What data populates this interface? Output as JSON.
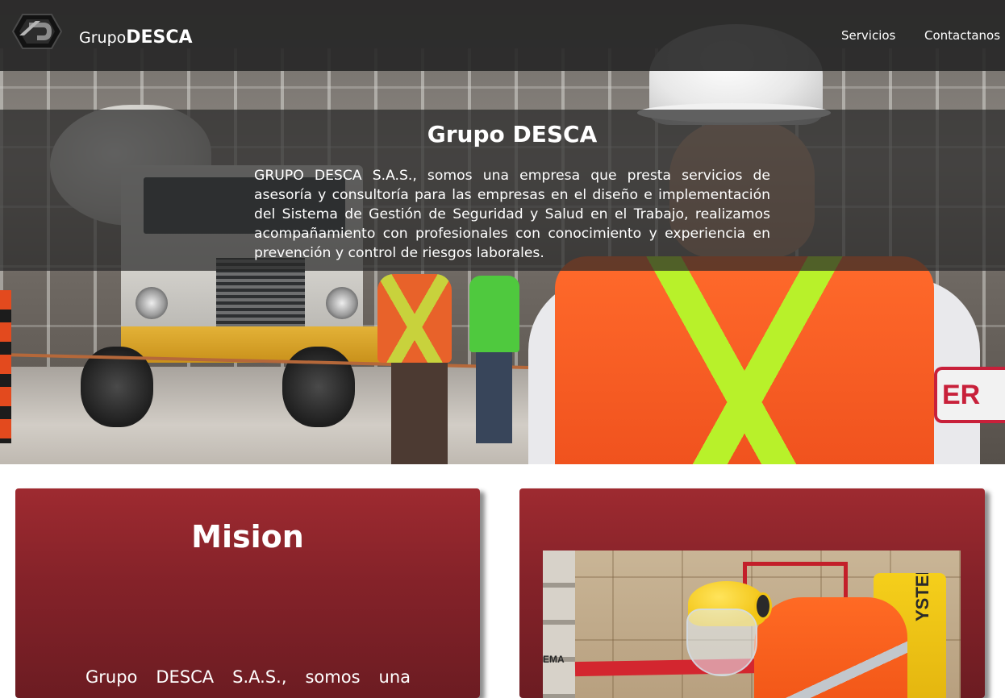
{
  "header": {
    "brand_prefix": "Grupo",
    "brand_strong": "DESCA",
    "nav": [
      {
        "label": "Servicios"
      },
      {
        "label": "Contactanos"
      }
    ]
  },
  "intro": {
    "title": "Grupo DESCA",
    "text": "GRUPO DESCA S.A.S., somos una empresa que presta servicios de asesoría y consultoría para las empresas en el diseño e implementación del Sistema de Gestión de Seguridad y Salud en el Trabajo, realizamos acompañamiento con profesionales con conocimiento y experiencia en prevención y control de riesgos laborales."
  },
  "mision": {
    "title": "Mision",
    "text": "Grupo DESCA S.A.S., somos una"
  },
  "photo_card": {
    "forklift_text": "YSTER",
    "shelf_label": "EMA"
  },
  "hero": {
    "sign_text": "ER"
  },
  "colors": {
    "navbar": "#262626",
    "card": "#842229",
    "vest_orange": "#f0521e",
    "reflective": "#b8f12a"
  }
}
